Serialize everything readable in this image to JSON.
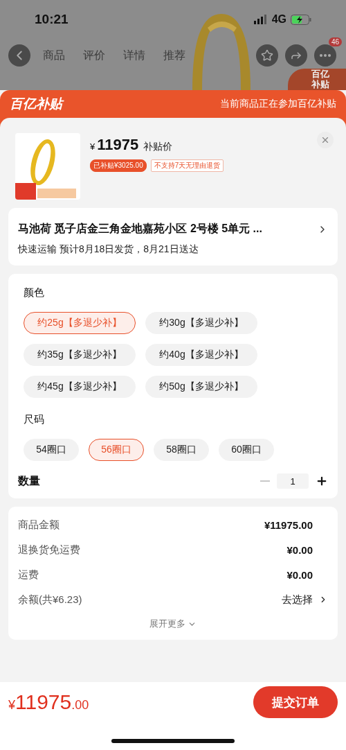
{
  "status_bar": {
    "time": "10:21",
    "network": "4G"
  },
  "nav": {
    "tabs": [
      "商品",
      "评价",
      "详情",
      "推荐"
    ],
    "badge": "46",
    "promo_badge": "百亿补贴"
  },
  "sheet_header": {
    "logo": "百亿补贴",
    "note": "当前商品正在参加百亿补贴"
  },
  "product": {
    "currency": "¥",
    "price": "11975",
    "price_label": "补贴价",
    "tags": [
      {
        "text": "已补贴¥3025.00",
        "kind": "filled"
      },
      {
        "text": "不支持7天无理由退货",
        "kind": "outline"
      }
    ]
  },
  "address": {
    "text": "马池荷  觅子店金三角金地嘉苑小区 2号楼 5单元 ...",
    "delivery": "快速运输 预计8月18日发货，8月21日送达"
  },
  "specs": [
    {
      "title": "颜色",
      "options": [
        {
          "label": "约25g【多退少补】",
          "selected": true
        },
        {
          "label": "约30g【多退少补】",
          "selected": false
        },
        {
          "label": "约35g【多退少补】",
          "selected": false
        },
        {
          "label": "约40g【多退少补】",
          "selected": false
        },
        {
          "label": "约45g【多退少补】",
          "selected": false
        },
        {
          "label": "约50g【多退少补】",
          "selected": false
        }
      ]
    },
    {
      "title": "尺码",
      "options": [
        {
          "label": "54圈口",
          "selected": false
        },
        {
          "label": "56圈口",
          "selected": true
        },
        {
          "label": "58圈口",
          "selected": false
        },
        {
          "label": "60圈口",
          "selected": false
        }
      ]
    }
  ],
  "quantity": {
    "label": "数量",
    "value": "1",
    "decrease_disabled": true
  },
  "summary": {
    "rows": [
      {
        "label": "商品金额",
        "value": "¥11975.00",
        "kind": "amount"
      },
      {
        "label": "退换货免运费",
        "value": "¥0.00",
        "kind": "amount"
      },
      {
        "label": "运费",
        "value": "¥0.00",
        "kind": "amount"
      },
      {
        "label": "余额(共¥6.23)",
        "value": "去选择",
        "kind": "link"
      }
    ],
    "expand": "展开更多"
  },
  "footer": {
    "currency": "¥",
    "total": "11975",
    "decimals": ".00",
    "submit": "提交订单"
  }
}
